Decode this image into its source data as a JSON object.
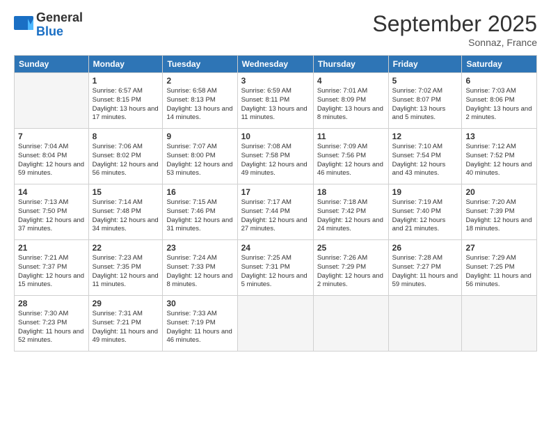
{
  "logo": {
    "general": "General",
    "blue": "Blue"
  },
  "title": "September 2025",
  "location": "Sonnaz, France",
  "days_header": [
    "Sunday",
    "Monday",
    "Tuesday",
    "Wednesday",
    "Thursday",
    "Friday",
    "Saturday"
  ],
  "weeks": [
    [
      {
        "num": "",
        "empty": true
      },
      {
        "num": "1",
        "sunrise": "6:57 AM",
        "sunset": "8:15 PM",
        "daylight": "13 hours and 17 minutes."
      },
      {
        "num": "2",
        "sunrise": "6:58 AM",
        "sunset": "8:13 PM",
        "daylight": "13 hours and 14 minutes."
      },
      {
        "num": "3",
        "sunrise": "6:59 AM",
        "sunset": "8:11 PM",
        "daylight": "13 hours and 11 minutes."
      },
      {
        "num": "4",
        "sunrise": "7:01 AM",
        "sunset": "8:09 PM",
        "daylight": "13 hours and 8 minutes."
      },
      {
        "num": "5",
        "sunrise": "7:02 AM",
        "sunset": "8:07 PM",
        "daylight": "13 hours and 5 minutes."
      },
      {
        "num": "6",
        "sunrise": "7:03 AM",
        "sunset": "8:06 PM",
        "daylight": "13 hours and 2 minutes."
      }
    ],
    [
      {
        "num": "7",
        "sunrise": "7:04 AM",
        "sunset": "8:04 PM",
        "daylight": "12 hours and 59 minutes."
      },
      {
        "num": "8",
        "sunrise": "7:06 AM",
        "sunset": "8:02 PM",
        "daylight": "12 hours and 56 minutes."
      },
      {
        "num": "9",
        "sunrise": "7:07 AM",
        "sunset": "8:00 PM",
        "daylight": "12 hours and 53 minutes."
      },
      {
        "num": "10",
        "sunrise": "7:08 AM",
        "sunset": "7:58 PM",
        "daylight": "12 hours and 49 minutes."
      },
      {
        "num": "11",
        "sunrise": "7:09 AM",
        "sunset": "7:56 PM",
        "daylight": "12 hours and 46 minutes."
      },
      {
        "num": "12",
        "sunrise": "7:10 AM",
        "sunset": "7:54 PM",
        "daylight": "12 hours and 43 minutes."
      },
      {
        "num": "13",
        "sunrise": "7:12 AM",
        "sunset": "7:52 PM",
        "daylight": "12 hours and 40 minutes."
      }
    ],
    [
      {
        "num": "14",
        "sunrise": "7:13 AM",
        "sunset": "7:50 PM",
        "daylight": "12 hours and 37 minutes."
      },
      {
        "num": "15",
        "sunrise": "7:14 AM",
        "sunset": "7:48 PM",
        "daylight": "12 hours and 34 minutes."
      },
      {
        "num": "16",
        "sunrise": "7:15 AM",
        "sunset": "7:46 PM",
        "daylight": "12 hours and 31 minutes."
      },
      {
        "num": "17",
        "sunrise": "7:17 AM",
        "sunset": "7:44 PM",
        "daylight": "12 hours and 27 minutes."
      },
      {
        "num": "18",
        "sunrise": "7:18 AM",
        "sunset": "7:42 PM",
        "daylight": "12 hours and 24 minutes."
      },
      {
        "num": "19",
        "sunrise": "7:19 AM",
        "sunset": "7:40 PM",
        "daylight": "12 hours and 21 minutes."
      },
      {
        "num": "20",
        "sunrise": "7:20 AM",
        "sunset": "7:39 PM",
        "daylight": "12 hours and 18 minutes."
      }
    ],
    [
      {
        "num": "21",
        "sunrise": "7:21 AM",
        "sunset": "7:37 PM",
        "daylight": "12 hours and 15 minutes."
      },
      {
        "num": "22",
        "sunrise": "7:23 AM",
        "sunset": "7:35 PM",
        "daylight": "12 hours and 11 minutes."
      },
      {
        "num": "23",
        "sunrise": "7:24 AM",
        "sunset": "7:33 PM",
        "daylight": "12 hours and 8 minutes."
      },
      {
        "num": "24",
        "sunrise": "7:25 AM",
        "sunset": "7:31 PM",
        "daylight": "12 hours and 5 minutes."
      },
      {
        "num": "25",
        "sunrise": "7:26 AM",
        "sunset": "7:29 PM",
        "daylight": "12 hours and 2 minutes."
      },
      {
        "num": "26",
        "sunrise": "7:28 AM",
        "sunset": "7:27 PM",
        "daylight": "11 hours and 59 minutes."
      },
      {
        "num": "27",
        "sunrise": "7:29 AM",
        "sunset": "7:25 PM",
        "daylight": "11 hours and 56 minutes."
      }
    ],
    [
      {
        "num": "28",
        "sunrise": "7:30 AM",
        "sunset": "7:23 PM",
        "daylight": "11 hours and 52 minutes."
      },
      {
        "num": "29",
        "sunrise": "7:31 AM",
        "sunset": "7:21 PM",
        "daylight": "11 hours and 49 minutes."
      },
      {
        "num": "30",
        "sunrise": "7:33 AM",
        "sunset": "7:19 PM",
        "daylight": "11 hours and 46 minutes."
      },
      {
        "num": "",
        "empty": true
      },
      {
        "num": "",
        "empty": true
      },
      {
        "num": "",
        "empty": true
      },
      {
        "num": "",
        "empty": true
      }
    ]
  ],
  "labels": {
    "sunrise": "Sunrise:",
    "sunset": "Sunset:",
    "daylight": "Daylight:"
  }
}
